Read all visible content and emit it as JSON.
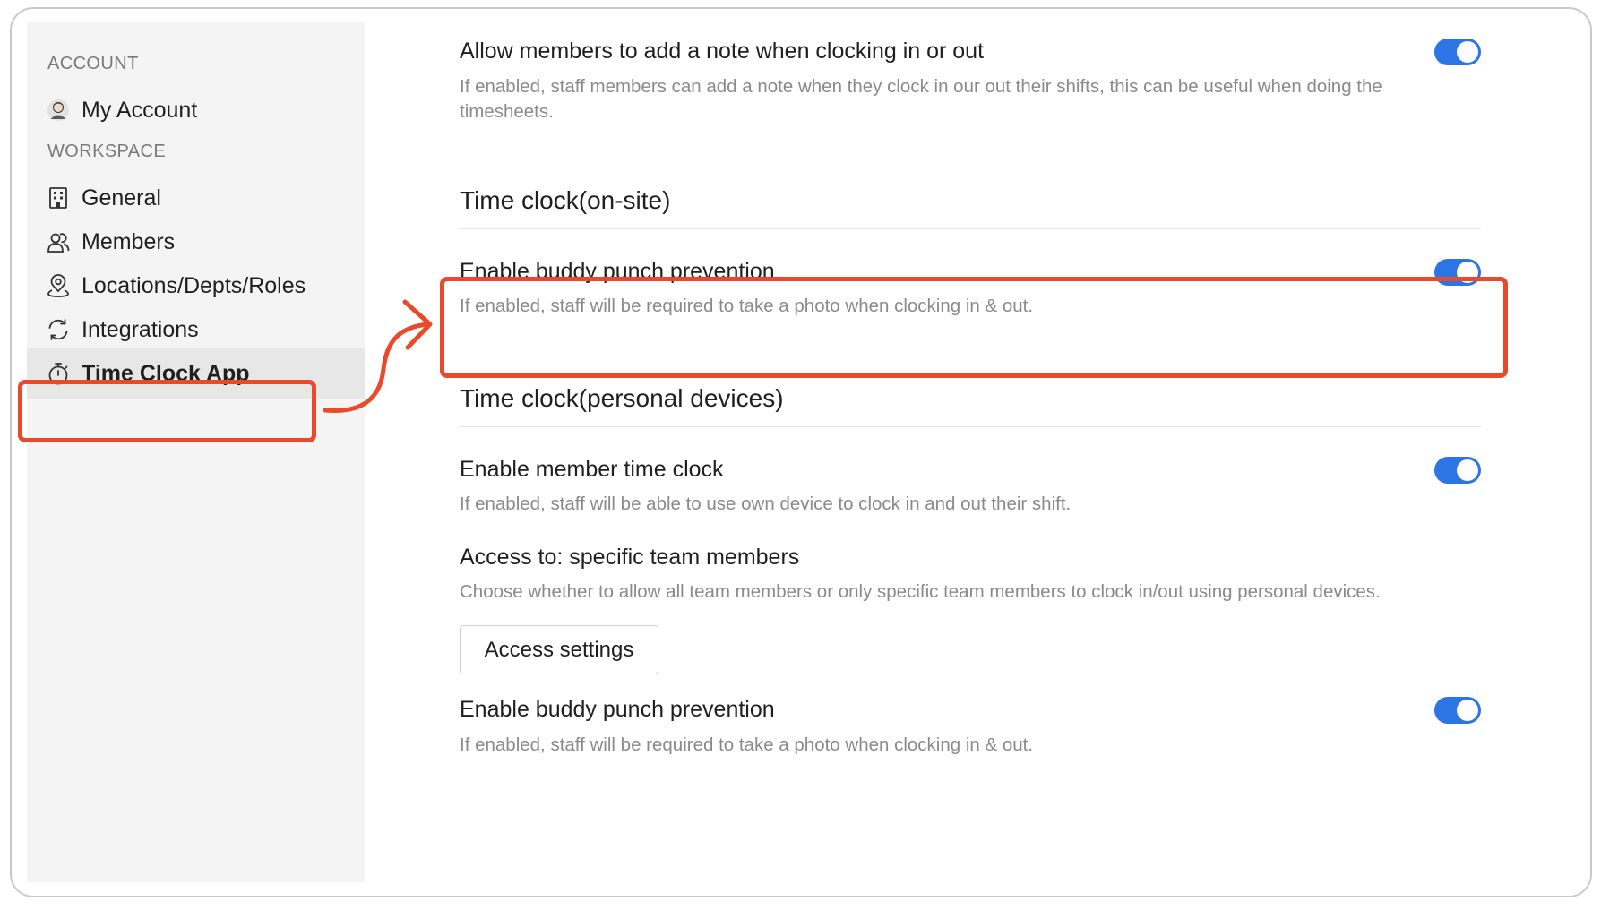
{
  "sidebar": {
    "account_section": "ACCOUNT",
    "workspace_section": "WORKSPACE",
    "items": [
      {
        "label": "My Account",
        "icon": "avatar-icon"
      },
      {
        "label": "General",
        "icon": "building-icon"
      },
      {
        "label": "Members",
        "icon": "members-icon"
      },
      {
        "label": "Locations/Depts/Roles",
        "icon": "location-pin-icon"
      },
      {
        "label": "Integrations",
        "icon": "sync-icon"
      },
      {
        "label": "Time Clock App",
        "icon": "stopwatch-icon",
        "active": true
      }
    ]
  },
  "settings": {
    "note": {
      "title": "Allow members to add a note when clocking in or out",
      "description": "If enabled, staff members can add a note when they clock in our out their shifts, this can be useful when doing the timesheets.",
      "enabled": true
    },
    "onsite": {
      "section_title": "Time clock(on-site)",
      "buddy_punch": {
        "title": "Enable buddy punch prevention",
        "description": "If enabled, staff will be required to take a photo when clocking in & out.",
        "enabled": true
      }
    },
    "personal": {
      "section_title": "Time clock(personal devices)",
      "member_clock": {
        "title": "Enable member time clock",
        "description": "If enabled, staff will be able to use own device to clock in and out their shift.",
        "enabled": true
      },
      "access": {
        "title": "Access to: specific team members",
        "description": "Choose whether to allow all team members or only specific team members to clock in/out using personal devices.",
        "button_label": "Access settings"
      },
      "buddy_punch": {
        "title": "Enable buddy punch prevention",
        "description": "If enabled, staff will be required to take a photo when clocking in & out.",
        "enabled": true
      }
    }
  },
  "colors": {
    "accent": "#2b75e6",
    "highlight": "#ea4a2a",
    "sidebar_bg": "#f4f4f4",
    "muted_text": "#8a8a8a"
  }
}
